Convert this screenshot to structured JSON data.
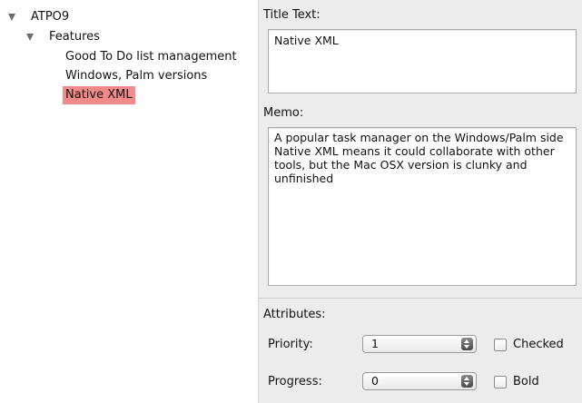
{
  "outline": {
    "root": {
      "label": "ATPO9",
      "expanded": true
    },
    "features": {
      "label": "Features",
      "expanded": true
    },
    "items": [
      {
        "label": "Good To Do list management",
        "selected": false
      },
      {
        "label": "Windows, Palm versions",
        "selected": false
      },
      {
        "label": "Native XML",
        "selected": true
      }
    ],
    "selection_color": "#f28a8a"
  },
  "inspector": {
    "title_label": "Title Text:",
    "title_value": "Native XML",
    "memo_label": "Memo:",
    "memo_value": "A popular task manager on the Windows/Palm side\nNative XML means it could collaborate with other\ntools, but the Mac OSX version is clunky and\nunfinished",
    "attributes_label": "Attributes:",
    "priority_label": "Priority:",
    "priority_value": "1",
    "progress_label": "Progress:",
    "progress_value": "0",
    "checked_label": "Checked",
    "checked_value": false,
    "bold_label": "Bold",
    "bold_value": false
  }
}
